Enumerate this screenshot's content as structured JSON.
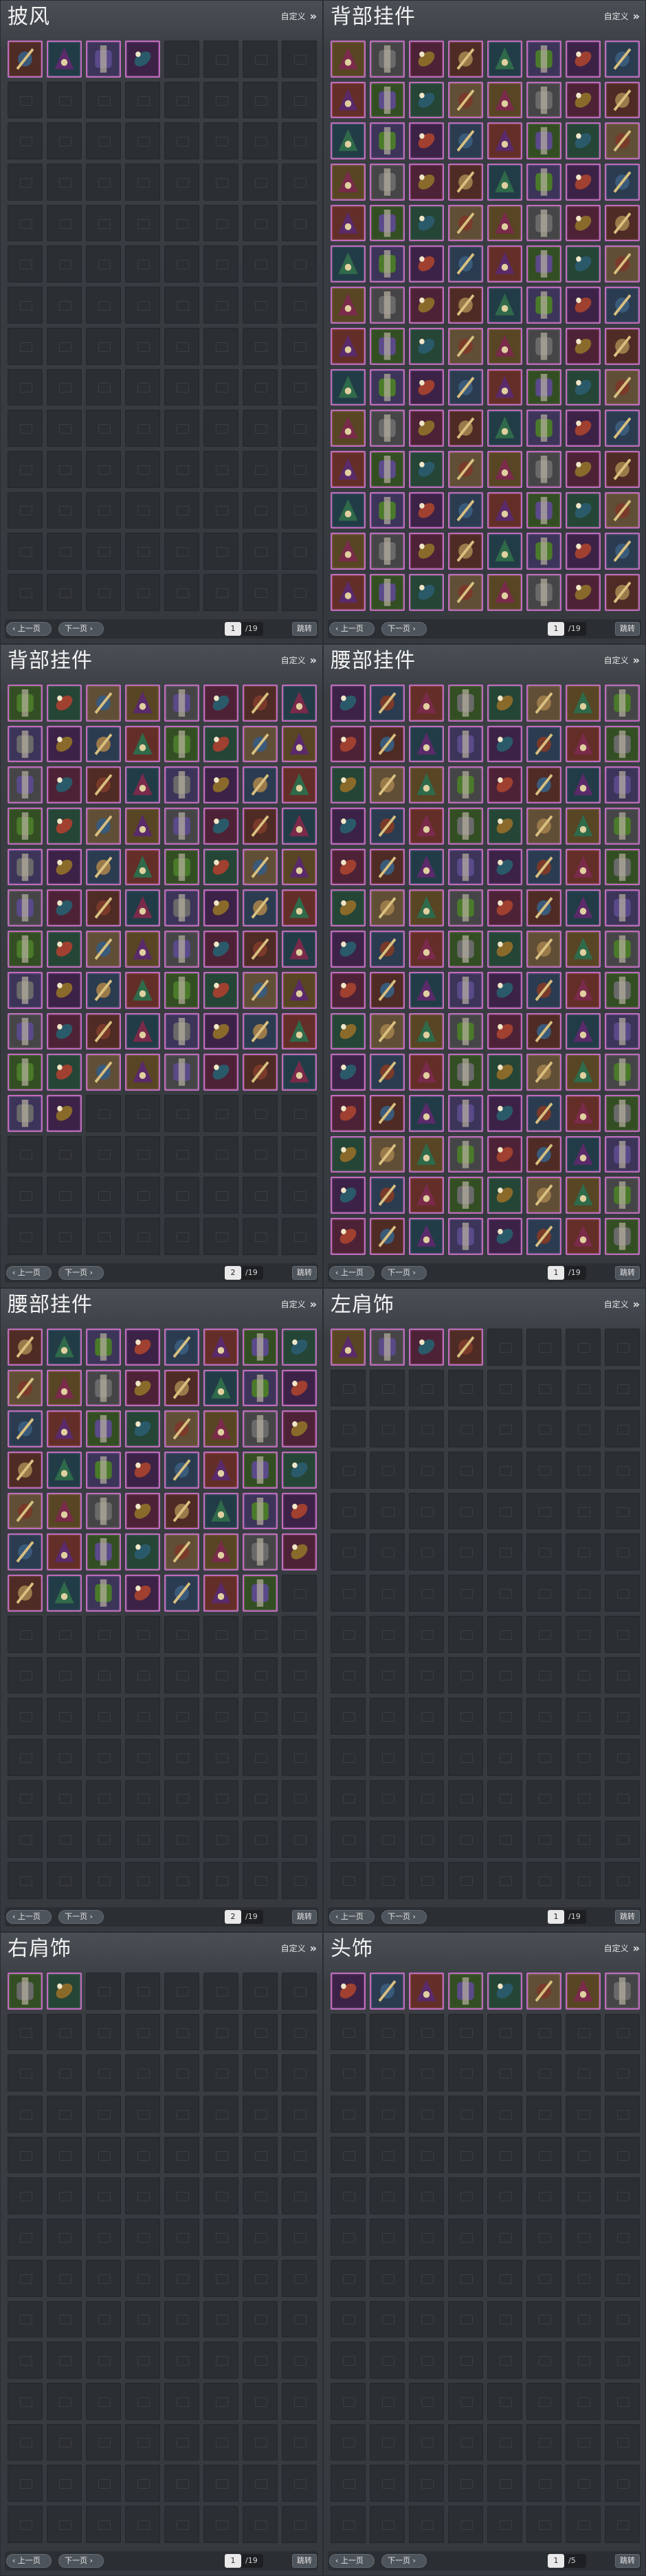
{
  "common": {
    "custom_label": "自定义",
    "prev_label": "上一页",
    "next_label": "下一页",
    "jump_label": "跳转"
  },
  "panels": [
    {
      "title": "披风",
      "filled": 4,
      "page": "1",
      "total": "/19"
    },
    {
      "title": "背部挂件",
      "filled": 112,
      "page": "1",
      "total": "/19"
    },
    {
      "title": "背部挂件",
      "filled": 82,
      "page": "2",
      "total": "/19"
    },
    {
      "title": "腰部挂件",
      "filled": 112,
      "page": "1",
      "total": "/19"
    },
    {
      "title": "腰部挂件",
      "filled": 55,
      "page": "2",
      "total": "/19"
    },
    {
      "title": "左肩饰",
      "filled": 4,
      "page": "1",
      "total": "/19"
    },
    {
      "title": "右肩饰",
      "filled": 2,
      "page": "1",
      "total": "/19"
    },
    {
      "title": "头饰",
      "filled": 8,
      "page": "1",
      "total": "/5"
    }
  ],
  "icon_palette": [
    "#7a3a2a",
    "#2f6a4a",
    "#5a4a8a",
    "#8a6a2a",
    "#3a5a7a",
    "#7a2a4a",
    "#4a7a2a",
    "#2a5a6a",
    "#9a7a4a",
    "#5a2a6a",
    "#6a6a6a",
    "#a04030"
  ]
}
